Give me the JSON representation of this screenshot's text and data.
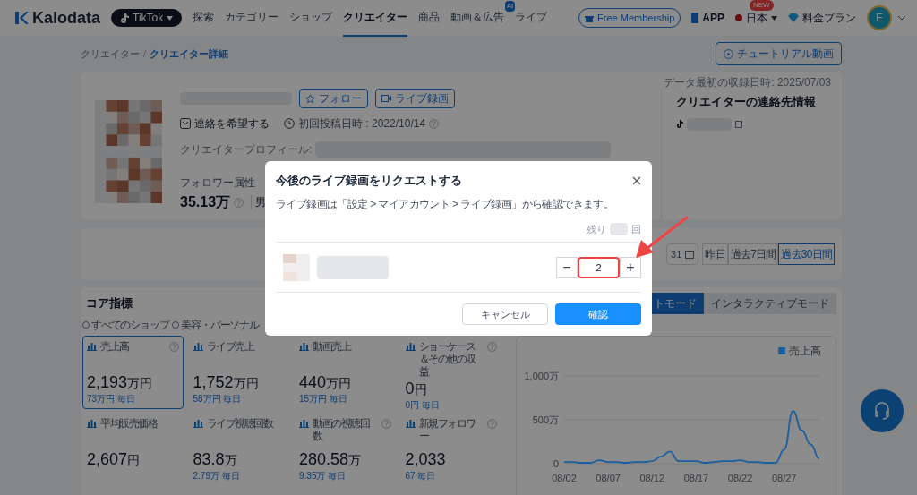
{
  "nav": {
    "logo": "Kalodata",
    "platform": "TikTok",
    "items": [
      {
        "label": "探索",
        "selected": false
      },
      {
        "label": "カテゴリー",
        "selected": false
      },
      {
        "label": "ショップ",
        "selected": false
      },
      {
        "label": "クリエイター",
        "selected": true
      },
      {
        "label": "商品",
        "selected": false
      },
      {
        "label": "動画＆広告",
        "selected": false,
        "badge": "AI"
      },
      {
        "label": "ライブ",
        "selected": false
      }
    ],
    "membership": "Free Membership",
    "app": "APP",
    "language": "日本",
    "language_badge": "NEW",
    "pricing": "料金プラン",
    "avatar": "E"
  },
  "breadcrumb": [
    {
      "label": "クリエイター",
      "selected": false
    },
    {
      "label": "クリエイター詳細",
      "selected": true
    }
  ],
  "breadcrumb_separator": "/",
  "tutorial": "チュートリアル動画",
  "creator": {
    "follow": "フォロー",
    "live_record": "ライブ録画",
    "contact": "連絡を希望する",
    "first_post": "初回投稿日時 : 2022/10/14",
    "profile_label": "クリエイタープロフィール:",
    "follower_label": "フォロワー属性",
    "followers": "35.13万",
    "gender_partial": "男",
    "data_date": "データ最初の収録日時: 2025/07/03",
    "contact_title": "クリエイターの連絡先情報"
  },
  "date_bar": {
    "date_partial": "31",
    "ranges": [
      {
        "label": "昨日",
        "selected": false
      },
      {
        "label": "過去7日間",
        "selected": false
      },
      {
        "label": "過去30日間",
        "selected": true
      }
    ]
  },
  "core": {
    "title": "コア指標",
    "filters": [
      "すべてのショップ",
      "美容・パーソナル"
    ],
    "modes": [
      {
        "label": "トモード",
        "selected": true
      },
      {
        "label": "インタラクティブモード",
        "selected": false
      }
    ],
    "metrics": [
      {
        "label": "売上高",
        "help": true,
        "value": "2,193",
        "unit": "万円",
        "daily": "73万円 毎日",
        "selected": true
      },
      {
        "label": "ライブ売上",
        "help": false,
        "value": "1,752",
        "unit": "万円",
        "daily": "58万円 毎日",
        "selected": false
      },
      {
        "label": "動画売上",
        "help": false,
        "value": "440",
        "unit": "万円",
        "daily": "15万円 毎日",
        "selected": false
      },
      {
        "label": "ショーケース＆その他の収益",
        "help": true,
        "value": "0",
        "unit": "円",
        "daily": "0円 毎日",
        "selected": false
      },
      {
        "label": "平均販売価格",
        "help": false,
        "value": "2,607",
        "unit": "円",
        "selected": false
      },
      {
        "label": "ライブ視聴回数",
        "help": false,
        "value": "83.8",
        "unit": "万",
        "daily": "2.79万 毎日",
        "selected": false
      },
      {
        "label": "動画の視聴回数",
        "help": true,
        "value": "280.58",
        "unit": "万",
        "daily": "9.35万 毎日",
        "selected": false
      },
      {
        "label": "新規フォロワー",
        "help": true,
        "value": "2,033",
        "daily": "67 毎日",
        "selected": false
      }
    ],
    "chart_data": {
      "type": "line",
      "categories": [
        "08/02",
        null,
        null,
        null,
        null,
        "08/07",
        null,
        null,
        null,
        null,
        "08/12",
        null,
        null,
        null,
        null,
        "08/17",
        null,
        null,
        null,
        null,
        "08/22",
        null,
        null,
        null,
        null,
        "08/27",
        null,
        null,
        null,
        null
      ],
      "yticks": [
        {
          "value": 0,
          "label": "0"
        },
        {
          "value": 500,
          "label": "500万"
        },
        {
          "value": 1000,
          "label": "1,000万"
        }
      ],
      "ylim": [
        0,
        1000
      ],
      "series": [
        {
          "name": "売上高",
          "color": "#1a5f9f",
          "values": [
            20,
            20,
            10,
            10,
            40,
            20,
            20,
            10,
            20,
            20,
            30,
            80,
            140,
            30,
            30,
            30,
            10,
            20,
            30,
            30,
            40,
            20,
            20,
            10,
            10,
            160,
            600,
            380,
            220,
            60
          ]
        }
      ]
    }
  },
  "dialog": {
    "title": "今後のライブ録画をリクエストする",
    "description": "ライブ録画は「設定 > マイアカウント > ライブ録画」から確認できます。",
    "remaining_label": "残り",
    "remaining_unit": "回",
    "minus": "−",
    "plus": "+",
    "quantity": "2",
    "cancel": "キャンセル",
    "confirm": "確認"
  }
}
